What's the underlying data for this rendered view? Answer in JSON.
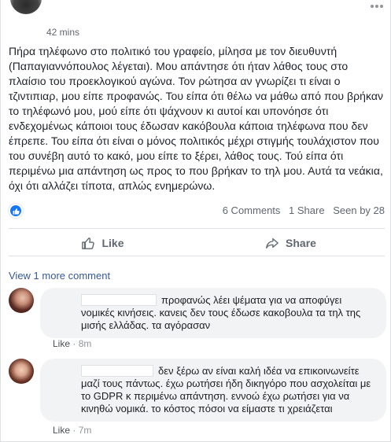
{
  "post": {
    "timestamp": "42 mins",
    "text": "Πήρα τηλέφωνο στο πολιτικό του γραφείο, μίλησα με τον διευθυντή (Παπαγιαννόπουλος λέγεται). Μου απάντησε ότι ήταν λάθος τους στο πλαίσιο του προεκλογικού αγώνα. Τον ρώτησα αν γνωρίζει τι είναι ο τζιντιπιαρ, μου είπε προφανώς. Του είπα ότι θέλω να μάθω από που βρήκαν το τηλέφωνό μου, μού είπε ότι ψάχνουν κι αυτοί και υπονόησε ότι ενδεχομένως κάποιοι τους έδωσαν κακόβουλα κάποια τηλέφωνα που δεν έπρεπε. Του είπα ότι είναι ο μόνος πολιτικός μέχρι στιγμής τουλάχιστον που του συνέβη αυτό το κακό, μου είπε το ξέρει, λάθος τους. Τού είπα ότι περιμένω μια απάντηση ως προς το που βρήκαν το τηλ μου. Αυτά τα νεάκια, όχι ότι αλλάζει τίποτα, απλώς ενημερώνω."
  },
  "stats": {
    "comments": "6 Comments",
    "shares": "1 Share",
    "seen": "Seen by 28"
  },
  "actions": {
    "like_label": "Like",
    "share_label": "Share"
  },
  "view_more": "View 1 more comment",
  "comments": [
    {
      "text": "προφανώς λέει ψέματα για να αποφύγει νομικές κινήσεις. κανεις δεν τους έδωσε κακοβουλα τα τηλ της μισής ελλάδας. τα αγόρασαν",
      "like_label": "Like",
      "time": "8m"
    },
    {
      "text": "δεν ξέρω αν είναι καλή ιδέα να επικοινωνείτε μαζί τους πάντως. έχω ρωτήσει ήδη δικηγόρο που ασχολείται με το GDPR κ περιμένω απάντηση. εννοώ έχω ρωτήσει για να κινηθώ νομικά. το κόστος πόσοι να είμαστε τι χρειάζεται",
      "like_label": "Like",
      "time": "7m"
    }
  ],
  "colors": {
    "accent": "#1877f2",
    "link": "#385898",
    "bubble": "#f2f3f5"
  },
  "icons": [
    "more-dots-icon",
    "like-thumb-icon",
    "share-arrow-icon"
  ]
}
